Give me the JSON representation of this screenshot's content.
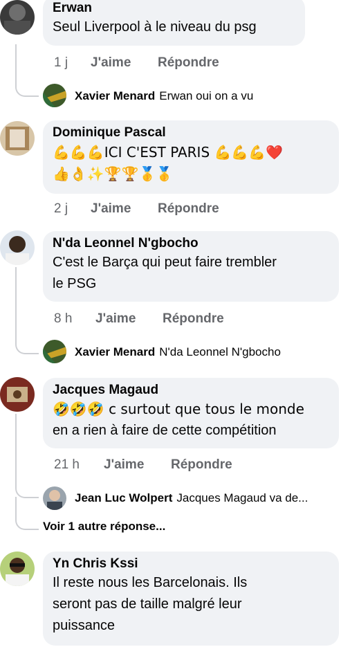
{
  "comments": [
    {
      "author": "Erwan",
      "text": "Seul Liverpool à le niveau du psg",
      "time": "1 j",
      "like": "J'aime",
      "reply": "Répondre"
    },
    {
      "author": "Dominique Pascal",
      "text_line1": "💪💪💪ICI C'EST PARIS 💪💪💪❤️",
      "text_line2": "👍👌✨🏆🏆🥇🥇",
      "time": "2 j",
      "like": "J'aime",
      "reply": "Répondre"
    },
    {
      "author": "N'da Leonnel N'gbocho",
      "text_line1": "C'est le Barça qui peut faire trembler",
      "text_line2": "le PSG",
      "time": "8 h",
      "like": "J'aime",
      "reply": "Répondre"
    },
    {
      "author": "Jacques Magaud",
      "text_line1": "🤣🤣🤣 c surtout que tous le monde",
      "text_line2": "en a rien à faire de cette compétition",
      "time": "21 h",
      "like": "J'aime",
      "reply": "Répondre"
    },
    {
      "author": "Yn Chris Kssi",
      "text_line1": "Il reste nous les Barcelonais. Ils",
      "text_line2": "seront pas de taille malgré leur",
      "text_line3": "puissance"
    }
  ],
  "replies": [
    {
      "author": "Xavier Menard",
      "preview": "Erwan oui on a vu"
    },
    {
      "author": "Xavier Menard",
      "preview": "N'da Leonnel N'gbocho"
    },
    {
      "author": "Jean Luc Wolpert",
      "preview": "Jacques Magaud va de..."
    }
  ],
  "more_replies": "Voir 1 autre réponse...",
  "colors": {
    "bubble": "#f0f2f5",
    "secondary_text": "#65676b",
    "thread_line": "#ced0d4"
  }
}
